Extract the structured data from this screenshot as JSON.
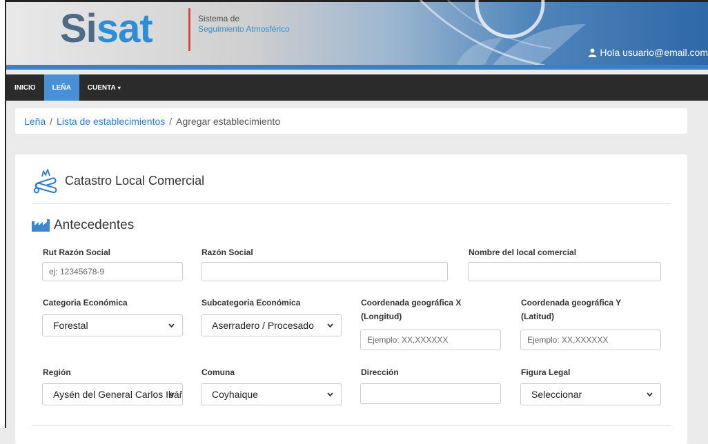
{
  "header": {
    "logo_part1": "Si",
    "logo_part2": "sat",
    "tagline_line1": "Sistema de",
    "tagline_line2": "Seguimiento Atmosférico",
    "user_greeting": "Hola usuario@email.com"
  },
  "nav": {
    "items": [
      {
        "label": "INICIO"
      },
      {
        "label": "LEÑA"
      },
      {
        "label": "CUENTA"
      }
    ]
  },
  "breadcrumb": {
    "item1": "Leña",
    "item2": "Lista de establecimientos",
    "current": "Agregar establecimiento",
    "separator": "/"
  },
  "card": {
    "title": "Catastro Local Comercial",
    "section_title": "Antecedentes"
  },
  "form": {
    "rut": {
      "label": "Rut Razón Social",
      "value": "",
      "placeholder": "ej: 12345678-9"
    },
    "razon_social": {
      "label": "Razón Social",
      "value": "",
      "placeholder": ""
    },
    "nombre_local": {
      "label": "Nombre del local comercial",
      "value": "",
      "placeholder": ""
    },
    "categoria": {
      "label": "Categoria Económica",
      "selected": "Forestal"
    },
    "subcategoria": {
      "label": "Subcategoria Económica",
      "selected": "Aserradero / Procesado"
    },
    "coord_x": {
      "label": "Coordenada geográfica X (Longitud)",
      "value": "",
      "placeholder": "Ejemplo: XX,XXXXXX"
    },
    "coord_y": {
      "label": "Coordenada geográfica Y (Latitud)",
      "value": "",
      "placeholder": "Ejemplo: XX,XXXXXX"
    },
    "region": {
      "label": "Región",
      "selected": "Aysén del General Carlos Ibáñez del Campo"
    },
    "comuna": {
      "label": "Comuna",
      "selected": "Coyhaique"
    },
    "direccion": {
      "label": "Dirección",
      "value": "",
      "placeholder": ""
    },
    "figura_legal": {
      "label": "Figura Legal",
      "selected": "Seleccionar"
    }
  },
  "colors": {
    "accent": "#4a90d6",
    "link": "#2a7bd4",
    "navbar": "#2b2b2b",
    "logo_red": "#e0433b"
  }
}
